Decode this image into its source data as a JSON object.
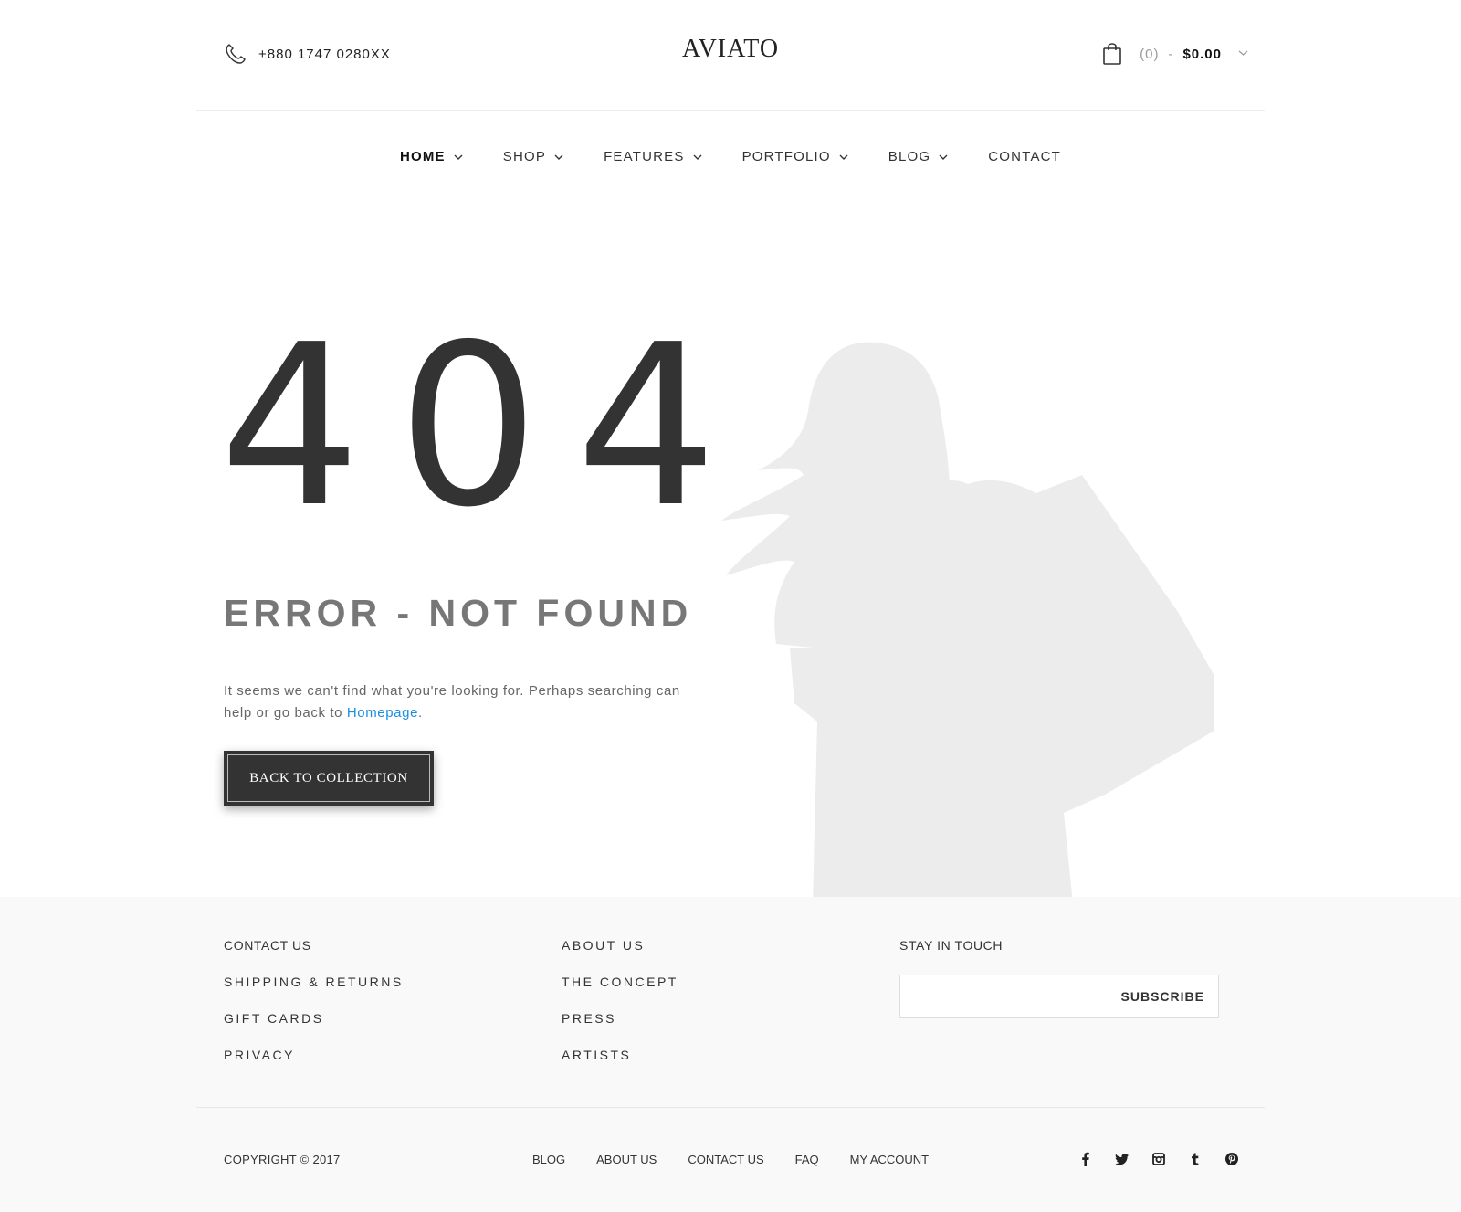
{
  "header": {
    "phone": "+880 1747 0280XX",
    "logo": "AVIATO",
    "cart": {
      "count": "(0)",
      "separator": "-",
      "total": "$0.00"
    }
  },
  "nav": [
    {
      "label": "HOME",
      "dropdown": true,
      "active": true
    },
    {
      "label": "SHOP",
      "dropdown": true
    },
    {
      "label": "FEATURES",
      "dropdown": true
    },
    {
      "label": "PORTFOLIO",
      "dropdown": true
    },
    {
      "label": "BLOG",
      "dropdown": true
    },
    {
      "label": "CONTACT",
      "dropdown": false
    }
  ],
  "error": {
    "code": "404",
    "title": "ERROR - NOT FOUND",
    "text_before": "It seems we can't find what you're looking for. Perhaps searching can help or go back to ",
    "link_text": "Homepage",
    "text_after": ".",
    "button": "BACK TO COLLECTION"
  },
  "footer": {
    "col1": [
      "CONTACT US",
      "SHIPPING & RETURNS",
      "GIFT CARDS",
      "PRIVACY"
    ],
    "col2": [
      "ABOUT US",
      "THE CONCEPT",
      "PRESS",
      "ARTISTS"
    ],
    "stay_title": "STAY IN TOUCH",
    "subscribe_placeholder": "",
    "subscribe_button": "SUBSCRIBE",
    "copyright": "COPYRIGHT © 2017",
    "bottom_links": [
      "BLOG",
      "ABOUT US",
      "CONTACT US",
      "FAQ",
      "MY ACCOUNT"
    ],
    "social": [
      "facebook-icon",
      "twitter-icon",
      "instagram-icon",
      "tumblr-icon",
      "pinterest-icon"
    ]
  },
  "colors": {
    "text_dark": "#333333",
    "link_blue": "#1a8ee1",
    "footer_bg": "#f9f9f9",
    "silhouette": "#ebebeb"
  }
}
